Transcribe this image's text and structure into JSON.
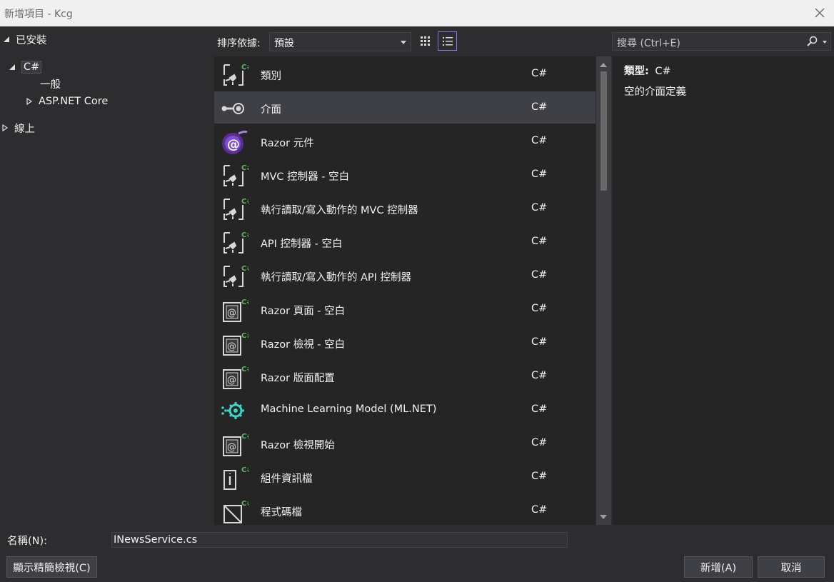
{
  "window": {
    "title": "新增項目 - Kcg"
  },
  "tree": {
    "installed": "已安裝",
    "csharp": "C#",
    "general": "一般",
    "aspnet": "ASP.NET Core",
    "online": "線上"
  },
  "toolbar": {
    "sort_label": "排序依據:",
    "sort_value": "預設",
    "search_placeholder": "搜尋 (Ctrl+E)"
  },
  "items": [
    {
      "name": "類別",
      "lang": "C#",
      "icon": "class-template-icon"
    },
    {
      "name": "介面",
      "lang": "C#",
      "icon": "interface-icon",
      "selected": true
    },
    {
      "name": "Razor 元件",
      "lang": "C#",
      "icon": "razor-component-icon"
    },
    {
      "name": "MVC 控制器 - 空白",
      "lang": "C#",
      "icon": "controller-template-icon"
    },
    {
      "name": "執行讀取/寫入動作的 MVC 控制器",
      "lang": "C#",
      "icon": "controller-template-icon"
    },
    {
      "name": "API 控制器 - 空白",
      "lang": "C#",
      "icon": "controller-template-icon"
    },
    {
      "name": "執行讀取/寫入動作的 API 控制器",
      "lang": "C#",
      "icon": "controller-template-icon"
    },
    {
      "name": "Razor 頁面 - 空白",
      "lang": "C#",
      "icon": "razor-page-icon"
    },
    {
      "name": "Razor 檢視 - 空白",
      "lang": "C#",
      "icon": "razor-page-icon"
    },
    {
      "name": "Razor 版面配置",
      "lang": "C#",
      "icon": "razor-page-icon"
    },
    {
      "name": "Machine Learning Model (ML.NET)",
      "lang": "C#",
      "icon": "ml-model-icon"
    },
    {
      "name": "Razor 檢視開始",
      "lang": "C#",
      "icon": "razor-page-icon"
    },
    {
      "name": "組件資訊檔",
      "lang": "C#",
      "icon": "assembly-info-icon"
    },
    {
      "name": "程式碼檔",
      "lang": "C#",
      "icon": "code-file-icon"
    }
  ],
  "details": {
    "type_label": "類型:",
    "type_value": "C#",
    "description": "空的介面定義"
  },
  "footer": {
    "name_label": "名稱(N):",
    "name_value": "INewsService.cs",
    "compact_view_button": "顯示精簡檢視(C)",
    "add_button": "新增(A)",
    "cancel_button": "取消"
  },
  "colors": {
    "accent": "#7f7cf0",
    "csharp_green": "#5fb85f",
    "list_bg": "#252526",
    "selected_bg": "#3f3f46"
  }
}
